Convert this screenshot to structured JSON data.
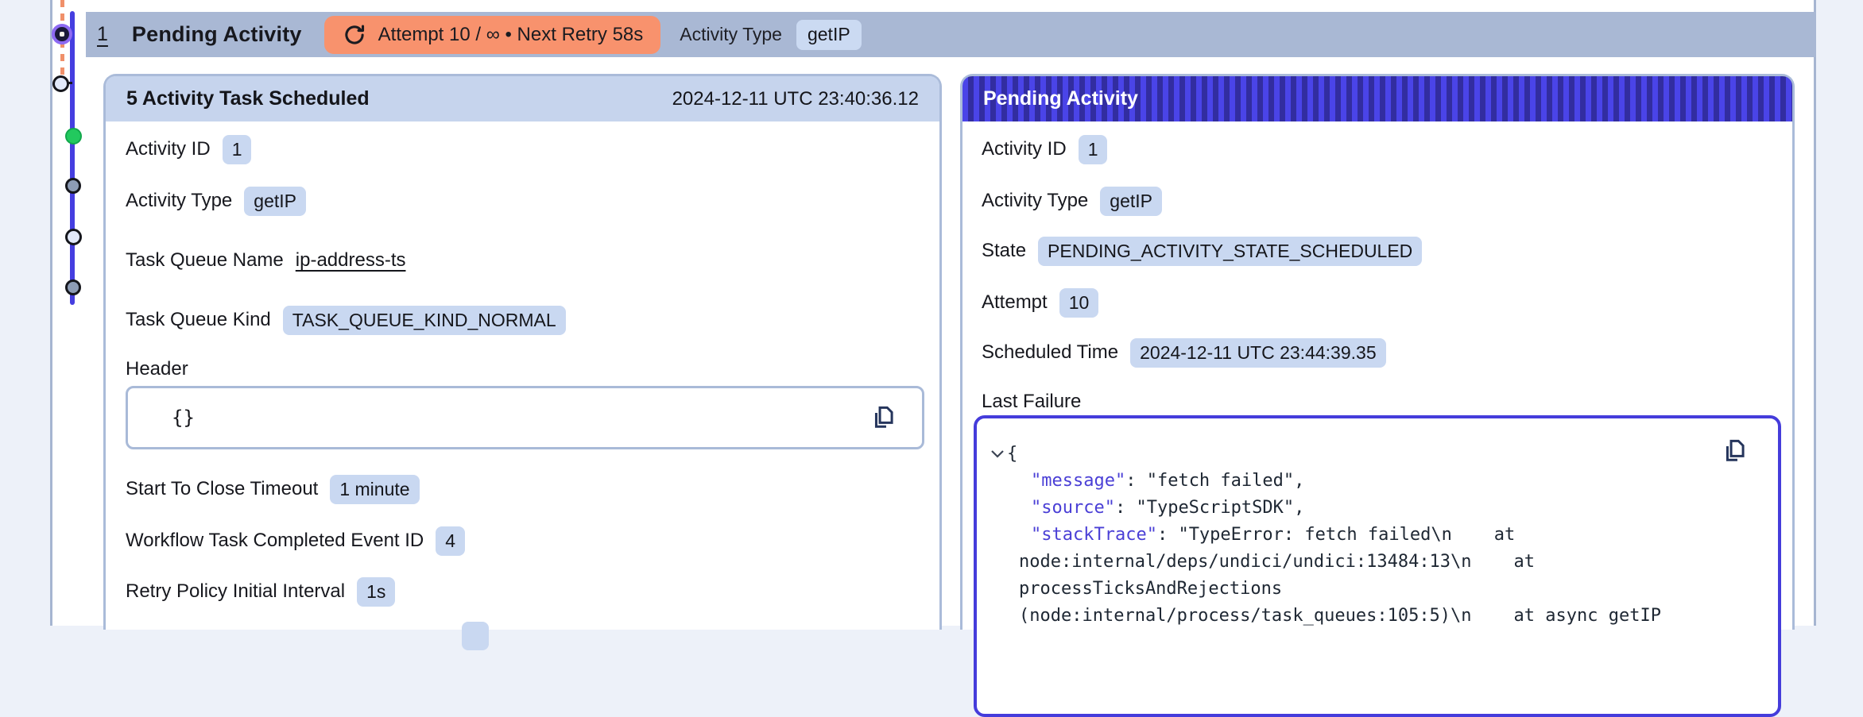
{
  "event_row": {
    "number": "1",
    "title": "Pending Activity",
    "retry_badge": {
      "label": "Attempt 10 / ∞ • Next Retry 58s"
    },
    "type_label": "Activity Type",
    "type_value": "getIP"
  },
  "timeline": {
    "dots": [
      {
        "state": "selected"
      },
      {
        "state": "open"
      },
      {
        "state": "green"
      },
      {
        "state": "gray"
      },
      {
        "state": "open"
      },
      {
        "state": "gray"
      }
    ]
  },
  "left_panel": {
    "header": {
      "title": "5 Activity Task Scheduled",
      "timestamp": "2024-12-11 UTC 23:40:36.12"
    },
    "rows": [
      {
        "label": "Activity ID",
        "value": "1",
        "kind": "badge"
      },
      {
        "label": "Activity Type",
        "value": "getIP",
        "kind": "badge"
      },
      {
        "label": "Task Queue Name",
        "value": "ip-address-ts",
        "kind": "link"
      },
      {
        "label": "Task Queue Kind",
        "value": "TASK_QUEUE_KIND_NORMAL",
        "kind": "badge"
      }
    ],
    "header_field": {
      "label": "Header",
      "code": "{}"
    },
    "rows2": [
      {
        "label": "Start To Close Timeout",
        "value": "1 minute",
        "kind": "badge"
      },
      {
        "label": "Workflow Task Completed Event ID",
        "value": "4",
        "kind": "badge"
      },
      {
        "label": "Retry Policy Initial Interval",
        "value": "1s",
        "kind": "badge"
      }
    ]
  },
  "right_panel": {
    "header": {
      "title": "Pending Activity"
    },
    "rows": [
      {
        "label": "Activity ID",
        "value": "1",
        "kind": "badge"
      },
      {
        "label": "Activity Type",
        "value": "getIP",
        "kind": "badge"
      },
      {
        "label": "State",
        "value": "PENDING_ACTIVITY_STATE_SCHEDULED",
        "kind": "badge"
      },
      {
        "label": "Attempt",
        "value": "10",
        "kind": "badge"
      },
      {
        "label": "Scheduled Time",
        "value": "2024-12-11 UTC 23:44:39.35",
        "kind": "badge"
      }
    ],
    "last_failure": {
      "label": "Last Failure",
      "lines": [
        {
          "indent": 0,
          "text": "{"
        },
        {
          "indent": 4,
          "key": "\"message\"",
          "text": ": \"fetch failed\","
        },
        {
          "indent": 4,
          "key": "\"source\"",
          "text": ": \"TypeScriptSDK\","
        },
        {
          "indent": 4,
          "key": "\"stackTrace\"",
          "text": ": \"TypeError: fetch failed\\n    at"
        },
        {
          "indent": 2,
          "text": "node:internal/deps/undici/undici:13484:13\\n    at"
        },
        {
          "indent": 2,
          "text": "processTicksAndRejections"
        },
        {
          "indent": 2,
          "text": "(node:internal/process/task_queues:105:5)\\n    at async getIP"
        }
      ]
    }
  },
  "colors": {
    "row_header_bg": "#a9b8d4",
    "retry_badge_bg": "#f8926d",
    "value_badge_bg": "#c9d8f1",
    "left_panel_header_bg": "#c6d4ed",
    "striped_header_blue": "#4a44e8",
    "striped_header_dark": "#322da0",
    "failure_border": "#453cdb",
    "json_key": "#4a3fd6",
    "timeline_blue": "#453ee0",
    "timeline_orange_dash": "#f0906a",
    "dot_green": "#22c95e",
    "dot_gray": "#8d9cb5"
  }
}
